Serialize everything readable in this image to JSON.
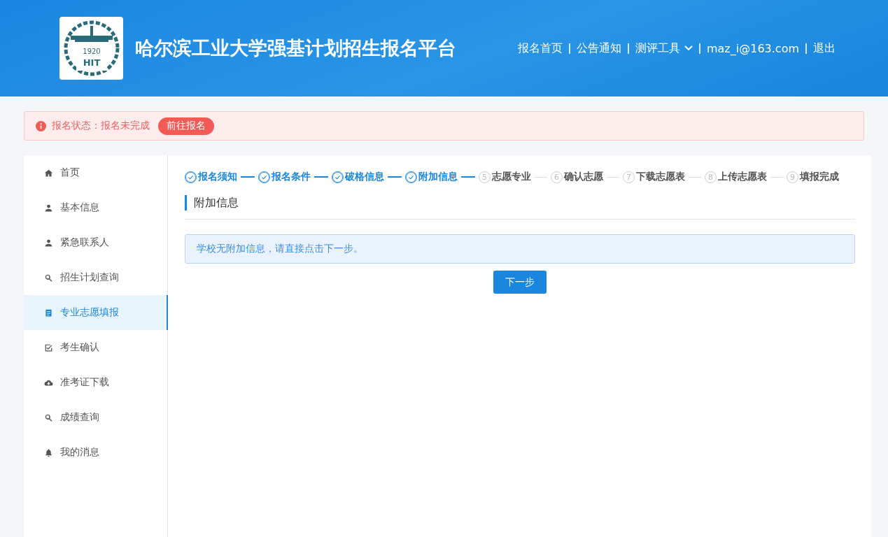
{
  "header": {
    "logo": {
      "year": "1920",
      "letters": "HIT"
    },
    "title": "哈尔滨工业大学强基计划招生报名平台",
    "nav": [
      {
        "label": "报名首页",
        "kind": "link"
      },
      {
        "label": "公告通知",
        "kind": "link"
      },
      {
        "label": "测评工具",
        "kind": "dropdown"
      },
      {
        "label": "maz_i@163.com",
        "kind": "link"
      },
      {
        "label": "退出",
        "kind": "link"
      }
    ]
  },
  "alert": {
    "text": "报名状态：报名未完成",
    "action": "前往报名"
  },
  "sidebar": {
    "items": [
      {
        "label": "首页",
        "selected": false
      },
      {
        "label": "基本信息",
        "selected": false
      },
      {
        "label": "紧急联系人",
        "selected": false
      },
      {
        "label": "招生计划查询",
        "selected": false
      },
      {
        "label": "专业志愿填报",
        "selected": true
      },
      {
        "label": "考生确认",
        "selected": false
      },
      {
        "label": "准考证下载",
        "selected": false
      },
      {
        "label": "成绩查询",
        "selected": false
      },
      {
        "label": "我的消息",
        "selected": false
      }
    ]
  },
  "steps": [
    {
      "label": "报名须知",
      "done": true
    },
    {
      "label": "报名条件",
      "done": true
    },
    {
      "label": "破格信息",
      "done": true
    },
    {
      "label": "附加信息",
      "done": true
    },
    {
      "label": "志愿专业",
      "done": false,
      "number": "5"
    },
    {
      "label": "确认志愿",
      "done": false,
      "number": "6"
    },
    {
      "label": "下载志愿表",
      "done": false,
      "number": "7"
    },
    {
      "label": "上传志愿表",
      "done": false,
      "number": "8"
    },
    {
      "label": "填报完成",
      "done": false,
      "number": "9"
    }
  ],
  "section": {
    "title": "附加信息",
    "notice": "学校无附加信息，请直接点击下一步。",
    "next_button": "下一步"
  }
}
